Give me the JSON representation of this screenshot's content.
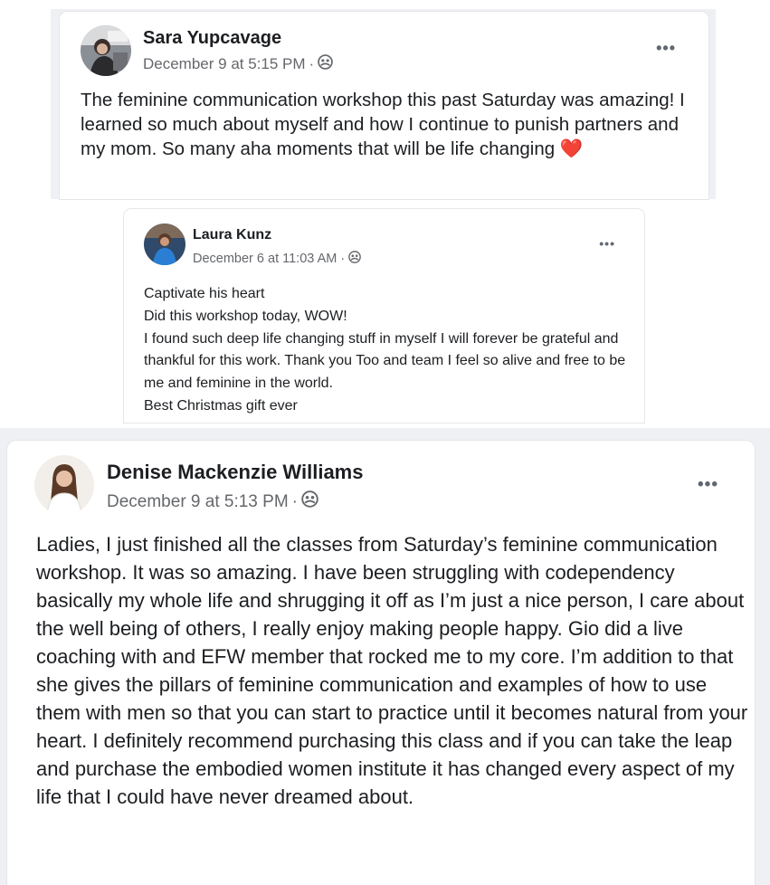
{
  "posts": [
    {
      "author": "Sara Yupcavage",
      "timestamp": "December 9 at 5:15 PM",
      "separator": "·",
      "audience_icon": "group-audience-icon",
      "more_label": "•••",
      "body": "The feminine communication workshop this past Saturday was amazing! I learned so much about myself and how I continue to punish partners and my mom. So many aha moments that will be life changing",
      "emoji": "❤️"
    },
    {
      "author": "Laura Kunz",
      "timestamp": "December 6 at 11:03 AM",
      "separator": "·",
      "audience_icon": "group-audience-icon",
      "more_label": "•••",
      "lines": [
        "Captivate his heart",
        "Did this workshop today, WOW!",
        "I found such deep life changing stuff in myself I will forever be grateful and thankful for this work. Thank you Too and team I feel so alive and free to be me and feminine in the world.",
        "Best Christmas gift ever"
      ]
    },
    {
      "author": "Denise Mackenzie Williams",
      "timestamp": "December 9 at 5:13 PM",
      "separator": "·",
      "audience_icon": "group-audience-icon",
      "more_label": "•••",
      "body": "Ladies, I just finished all the classes from Saturday’s feminine communication workshop. It was so amazing. I have been struggling with codependency basically my whole life and shrugging it off as I’m just a nice person, I care about the well being of others, I really enjoy making people happy. Gio did a live coaching with and EFW member that rocked me to my core.  I’m addition to that she gives the pillars of feminine communication and examples of how to use them with men so that you can start to practice until it becomes natural from your heart. I definitely recommend purchasing this class and if you can take the leap and purchase the embodied women institute it has changed every aspect of my life that I could have never dreamed about."
    }
  ],
  "colors": {
    "text": "#1c1e21",
    "meta": "#65676b",
    "background_strip": "#eef0f3",
    "heart": "#e0245e"
  }
}
